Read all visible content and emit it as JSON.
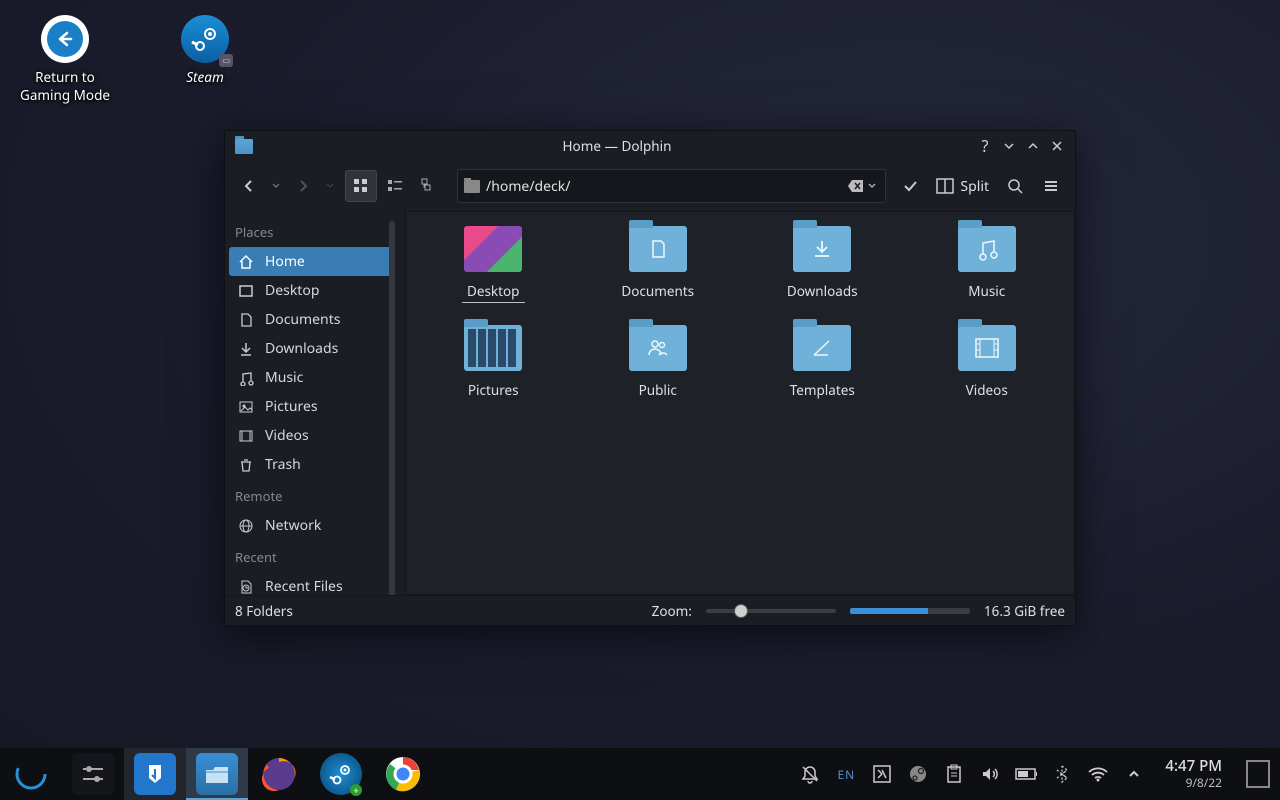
{
  "desktop": {
    "icons": [
      {
        "name": "return-to-gaming",
        "label": "Return to\nGaming Mode"
      },
      {
        "name": "steam",
        "label": "Steam"
      }
    ]
  },
  "window": {
    "title": "Home — Dolphin",
    "path": "/home/deck/",
    "split_label": "Split"
  },
  "sidebar": {
    "sections": [
      {
        "header": "Places",
        "items": [
          "Home",
          "Desktop",
          "Documents",
          "Downloads",
          "Music",
          "Pictures",
          "Videos",
          "Trash"
        ],
        "selected": 0
      },
      {
        "header": "Remote",
        "items": [
          "Network"
        ]
      },
      {
        "header": "Recent",
        "items": [
          "Recent Files"
        ]
      }
    ]
  },
  "folders": [
    "Desktop",
    "Documents",
    "Downloads",
    "Music",
    "Pictures",
    "Public",
    "Templates",
    "Videos"
  ],
  "selected_folder": 0,
  "status": {
    "count": "8 Folders",
    "zoom_label": "Zoom:",
    "free": "16.3 GiB free"
  },
  "taskbar": {
    "apps": [
      "launcher",
      "settings",
      "discover",
      "dolphin",
      "firefox",
      "steam",
      "chrome"
    ],
    "active": 3,
    "tray": {
      "lang": "EN"
    },
    "time": "4:47 PM",
    "date": "9/8/22"
  }
}
